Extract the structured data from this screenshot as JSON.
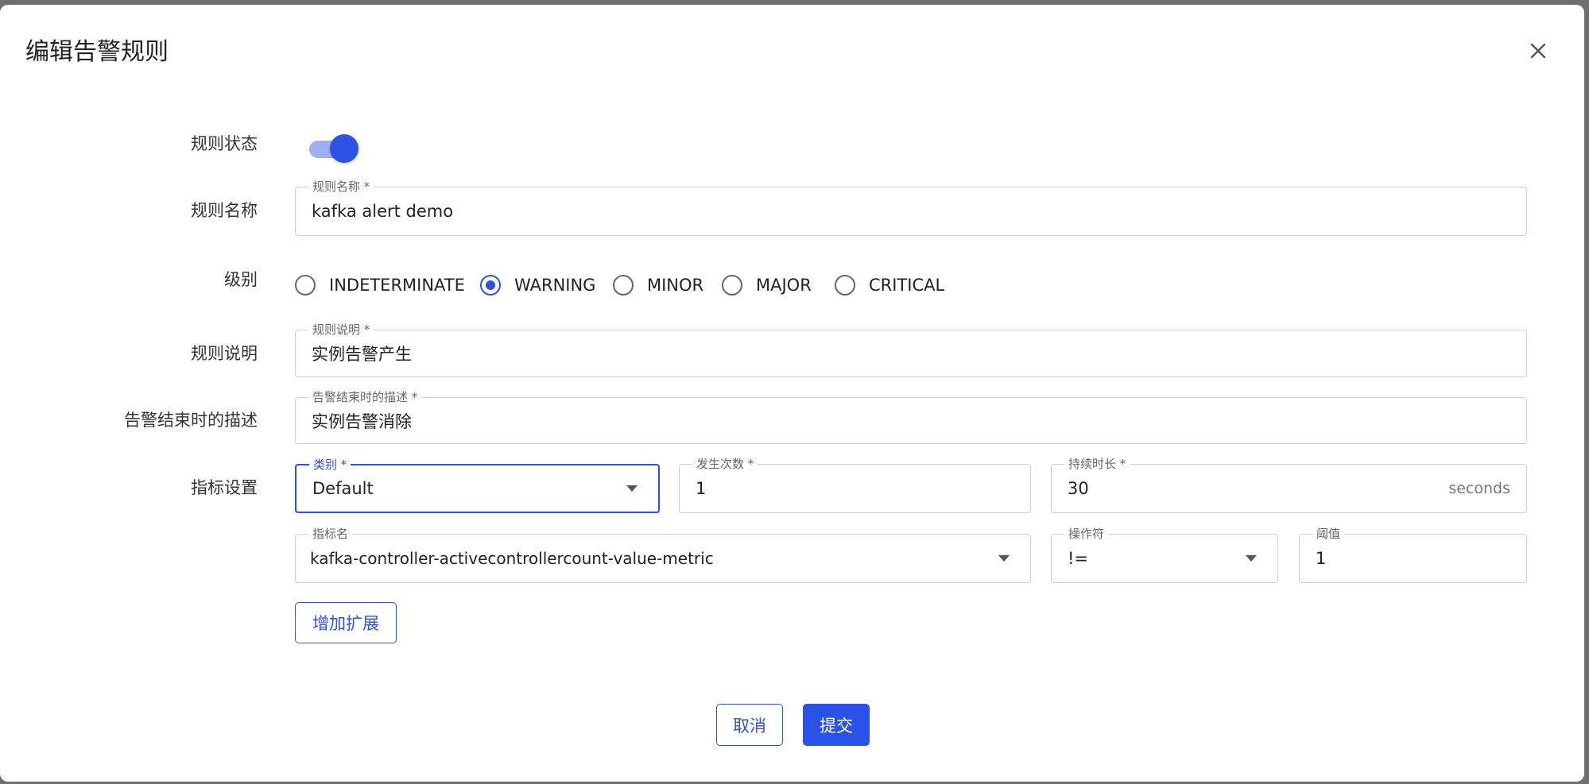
{
  "dialog": {
    "title": "编辑告警规则"
  },
  "icons": {
    "close": "close-icon",
    "dropdown": "caret-down-icon"
  },
  "colors": {
    "accent": "#2b52e6",
    "switch_track": "#9fb0f2"
  },
  "form": {
    "status": {
      "label": "规则状态",
      "enabled": true
    },
    "name": {
      "label": "规则名称",
      "field_label": "规则名称 *",
      "value": "kafka alert demo"
    },
    "level": {
      "label": "级别",
      "options": [
        "INDETERMINATE",
        "WARNING",
        "MINOR",
        "MAJOR",
        "CRITICAL"
      ],
      "selected": "WARNING"
    },
    "description": {
      "label": "规则说明",
      "field_label": "规则说明 *",
      "value": "实例告警产生"
    },
    "end_description": {
      "label": "告警结束时的描述",
      "field_label": "告警结束时的描述 *",
      "value": "实例告警消除"
    },
    "metric": {
      "label": "指标设置",
      "category": {
        "field_label": "类别 *",
        "value": "Default"
      },
      "occurrences": {
        "field_label": "发生次数 *",
        "value": "1"
      },
      "duration": {
        "field_label": "持续时长 *",
        "value": "30",
        "suffix": "seconds"
      },
      "metric_name": {
        "field_label": "指标名",
        "value": "kafka-controller-activecontrollercount-value-metric"
      },
      "operator": {
        "field_label": "操作符",
        "value": "!="
      },
      "threshold": {
        "field_label": "阈值",
        "value": "1"
      }
    },
    "add_extension_label": "增加扩展"
  },
  "footer": {
    "cancel_label": "取消",
    "submit_label": "提交"
  }
}
